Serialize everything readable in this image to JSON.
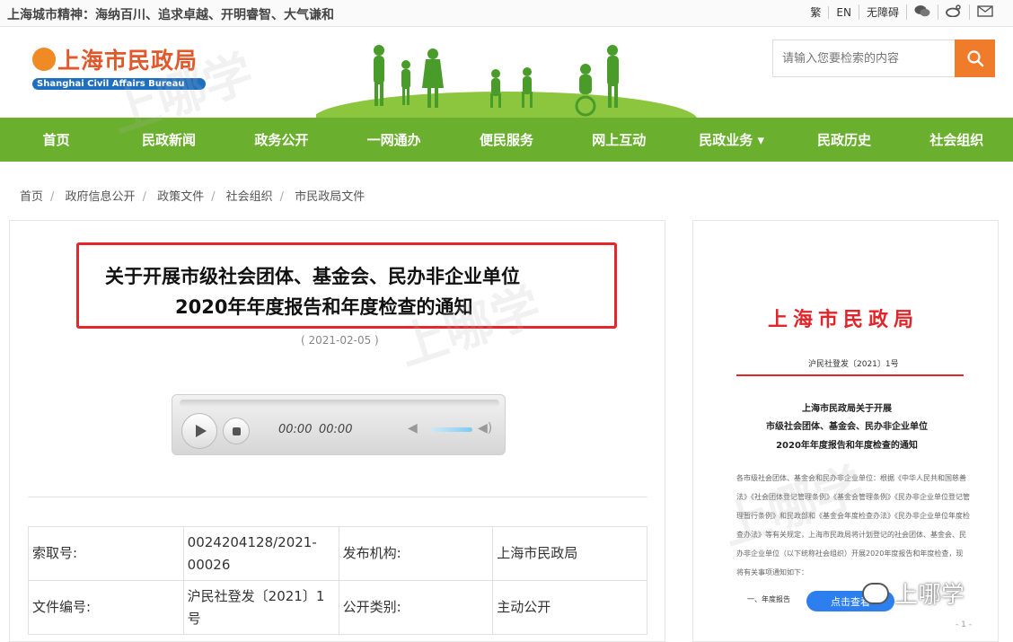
{
  "topbar": {
    "spirit": "上海城市精神：海纳百川、追求卓越、开明睿智、大气谦和",
    "links": [
      "繁",
      "EN",
      "无障碍"
    ],
    "icons": [
      "wechat-icon",
      "weibo-icon",
      "mail-icon"
    ]
  },
  "header": {
    "logo_cn": "上海市民政局",
    "logo_en": "Shanghai Civil Affairs Bureau",
    "search_placeholder": "请输入您要检索的内容"
  },
  "nav": {
    "items": [
      "首页",
      "民政新闻",
      "政务公开",
      "一网通办",
      "便民服务",
      "网上互动",
      "民政业务 ▾",
      "民政历史",
      "社会组织"
    ]
  },
  "breadcrumb": [
    "首页",
    "政府信息公开",
    "政策文件",
    "社会组织",
    "市民政局文件"
  ],
  "article": {
    "title_line1": "关于开展市级社会团体、基金会、民办非企业单位",
    "title_line2": "2020年年度报告和年度检查的通知",
    "date": "( 2021-02-05 )",
    "player": {
      "current": "00:00",
      "total": "00:00"
    }
  },
  "meta_table": {
    "rows": [
      {
        "k1": "索取号:",
        "v1": "0024204128/2021-00026",
        "k2": "发布机构:",
        "v2": "上海市民政局"
      },
      {
        "k1": "文件编号:",
        "v1": "沪民社登发〔2021〕1号",
        "k2": "公开类别:",
        "v2": "主动公开"
      }
    ]
  },
  "doc_preview": {
    "head": "上海市民政局",
    "number": "沪民社登发〔2021〕1号",
    "title_lines": [
      "上海市民政局关于开展",
      "市级社会团体、基金会、民办非企业单位",
      "2020年年度报告和年度检查的通知"
    ],
    "body": "各市级社会团体、基金会和民办非企业单位：根据《中华人民共和国慈善法》《社会团体登记管理条例》《基金会管理条例》《民办非企业单位登记管理暂行条例》和民政部和《基金会年度检查办法》《民办非企业单位年度检查办法》等有关规定，上海市民政局将计划登记的社会团体、基金会、民办非企业单位（以下统称社会组织）开展2020年度报告和年度检查，现将有关事项通知如下：",
    "foot": "一、年度报告",
    "button": "点击查看",
    "page": "- 1 -"
  },
  "watermark": {
    "brand": "上哪学"
  },
  "colors": {
    "nav_green": "#6ab02e",
    "accent_orange": "#f07c2b",
    "title_red": "#e5262b"
  }
}
